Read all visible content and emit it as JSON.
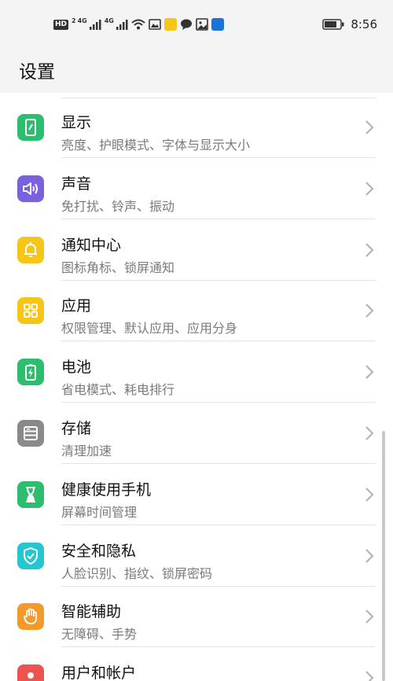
{
  "status_bar": {
    "hd_label": "HD",
    "hd_num": "2",
    "signal1_label": "4G",
    "signal2_label": "4G",
    "time": "8:56",
    "icons": [
      "hd-icon",
      "signal-icon",
      "signal-icon",
      "wifi-icon",
      "photo-icon",
      "chat-icon",
      "message-icon",
      "gallery-icon",
      "app-icon",
      "battery-icon"
    ]
  },
  "header": {
    "title": "设置"
  },
  "settings": [
    {
      "title": "显示",
      "subtitle": "亮度、护眼模式、字体与显示大小",
      "icon": "display-icon",
      "color": "#2dbd6e"
    },
    {
      "title": "声音",
      "subtitle": "免打扰、铃声、振动",
      "icon": "sound-icon",
      "color": "#7b61e0"
    },
    {
      "title": "通知中心",
      "subtitle": "图标角标、锁屏通知",
      "icon": "bell-icon",
      "color": "#f5c518"
    },
    {
      "title": "应用",
      "subtitle": "权限管理、默认应用、应用分身",
      "icon": "apps-icon",
      "color": "#f5c518"
    },
    {
      "title": "电池",
      "subtitle": "省电模式、耗电排行",
      "icon": "battery-icon",
      "color": "#2dbd6e"
    },
    {
      "title": "存储",
      "subtitle": "清理加速",
      "icon": "storage-icon",
      "color": "#8a8a8a"
    },
    {
      "title": "健康使用手机",
      "subtitle": "屏幕时间管理",
      "icon": "hourglass-icon",
      "color": "#2dbd6e"
    },
    {
      "title": "安全和隐私",
      "subtitle": "人脸识别、指纹、锁屏密码",
      "icon": "shield-icon",
      "color": "#25c6cf"
    },
    {
      "title": "智能辅助",
      "subtitle": "无障碍、手势",
      "icon": "hand-icon",
      "color": "#f39a2b"
    },
    {
      "title": "用户和帐户",
      "subtitle": "",
      "icon": "user-icon",
      "color": "#ef5350"
    }
  ]
}
